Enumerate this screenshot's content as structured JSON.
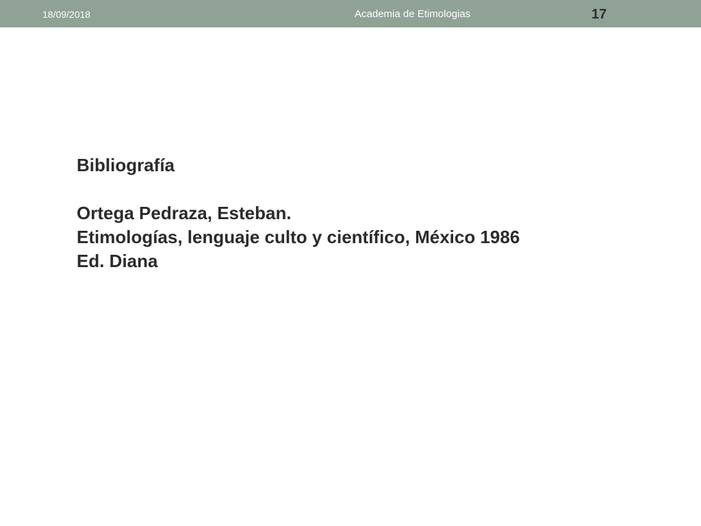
{
  "header": {
    "date": "18/09/2018",
    "title": "Academia de Etimologias",
    "page_number": "17",
    "bar_color": "#8fa295"
  },
  "content": {
    "heading": "Bibliografía",
    "author": "Ortega Pedraza, Esteban.",
    "work": "Etimologías, lenguaje culto y científico, México 1986",
    "publisher": "Ed. Diana"
  }
}
